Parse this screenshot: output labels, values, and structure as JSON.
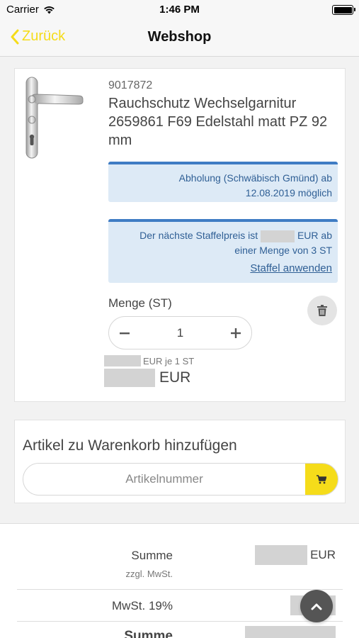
{
  "status_bar": {
    "carrier": "Carrier",
    "time": "1:46 PM",
    "battery_level": 1.0
  },
  "nav": {
    "back_label": "Zurück",
    "title": "Webshop"
  },
  "product": {
    "article_number": "9017872",
    "name": "Rauchschutz Wechselgarnitur 2659861 F69 Edelstahl matt PZ 92 mm",
    "pickup_line1": "Abholung (Schwäbisch Gmünd) ab",
    "pickup_line2": "12.08.2019 möglich",
    "staffel_text_a": "Der nächste Staffelpreis ist",
    "staffel_text_b": "EUR ab",
    "staffel_line2": "einer Menge von 3 ST",
    "staffel_link": "Staffel anwenden",
    "qty_label": "Menge (ST)",
    "qty_value": "1",
    "unit_price_suffix": "EUR je 1 ST",
    "total_currency": "EUR"
  },
  "add_article": {
    "title": "Artikel zu Warenkorb hinzufügen",
    "placeholder": "Artikelnummer"
  },
  "summary": {
    "sum_label": "Summe",
    "sum_sub": "zzgl. MwSt.",
    "sum_currency": "EUR",
    "vat_label": "MwSt. 19%",
    "total_label": "Summe"
  },
  "colors": {
    "accent": "#f5dc1a",
    "info_border": "#3f7cc4",
    "info_bg": "#ddeaf6"
  },
  "icons": [
    "wifi-icon",
    "battery-icon",
    "chevron-left-icon",
    "trash-icon",
    "minus-icon",
    "plus-icon",
    "cart-icon",
    "chevron-up-icon"
  ]
}
